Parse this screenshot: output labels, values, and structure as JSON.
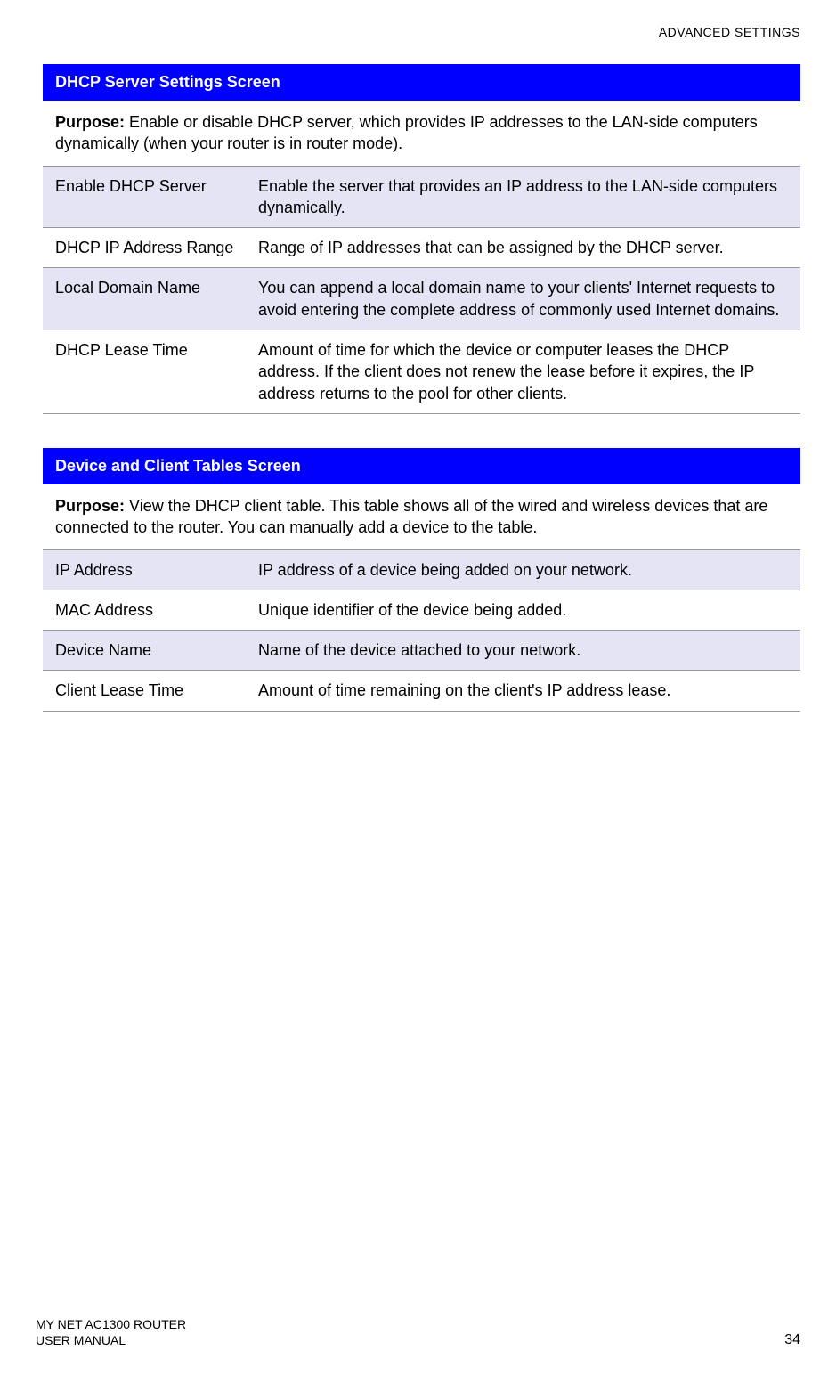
{
  "header": {
    "right": "ADVANCED SETTINGS"
  },
  "sections": [
    {
      "title": "DHCP Server Settings Screen",
      "purpose_label": "Purpose: ",
      "purpose_text": "Enable or disable DHCP server, which provides IP addresses to the LAN-side computers dynamically (when your router is in router mode).",
      "rows": [
        {
          "label": "Enable DHCP Server",
          "desc": "Enable the server that provides an IP address to the LAN-side computers dynamically.",
          "shaded": true
        },
        {
          "label": "DHCP IP Address Range",
          "desc": "Range of IP addresses that can be assigned by the DHCP server.",
          "shaded": false
        },
        {
          "label": "Local Domain Name",
          "desc": "You can append a local domain name to your clients' Internet requests to avoid entering the complete address of commonly used Internet domains.",
          "shaded": true
        },
        {
          "label": "DHCP Lease Time",
          "desc": "Amount of time for which the device or computer leases the DHCP address. If the client does not renew the lease before it expires, the IP address returns to the pool for other clients.",
          "shaded": false
        }
      ]
    },
    {
      "title": "Device and Client Tables Screen",
      "purpose_label": "Purpose: ",
      "purpose_text": "View the DHCP client table. This table shows all of the wired and wireless devices that are connected to the router. You can manually add a device to the table.",
      "rows": [
        {
          "label": "IP Address",
          "desc": "IP address of a device being added on your network.",
          "shaded": true
        },
        {
          "label": "MAC Address",
          "desc": "Unique identifier of the device being added.",
          "shaded": false
        },
        {
          "label": "Device Name",
          "desc": "Name of the device attached to your network.",
          "shaded": true
        },
        {
          "label": "Client Lease Time",
          "desc": "Amount of time remaining on the client's IP address lease.",
          "shaded": false
        }
      ]
    }
  ],
  "footer": {
    "left_line1": "MY NET AC1300 ROUTER",
    "left_line2": "USER MANUAL",
    "page": "34"
  }
}
